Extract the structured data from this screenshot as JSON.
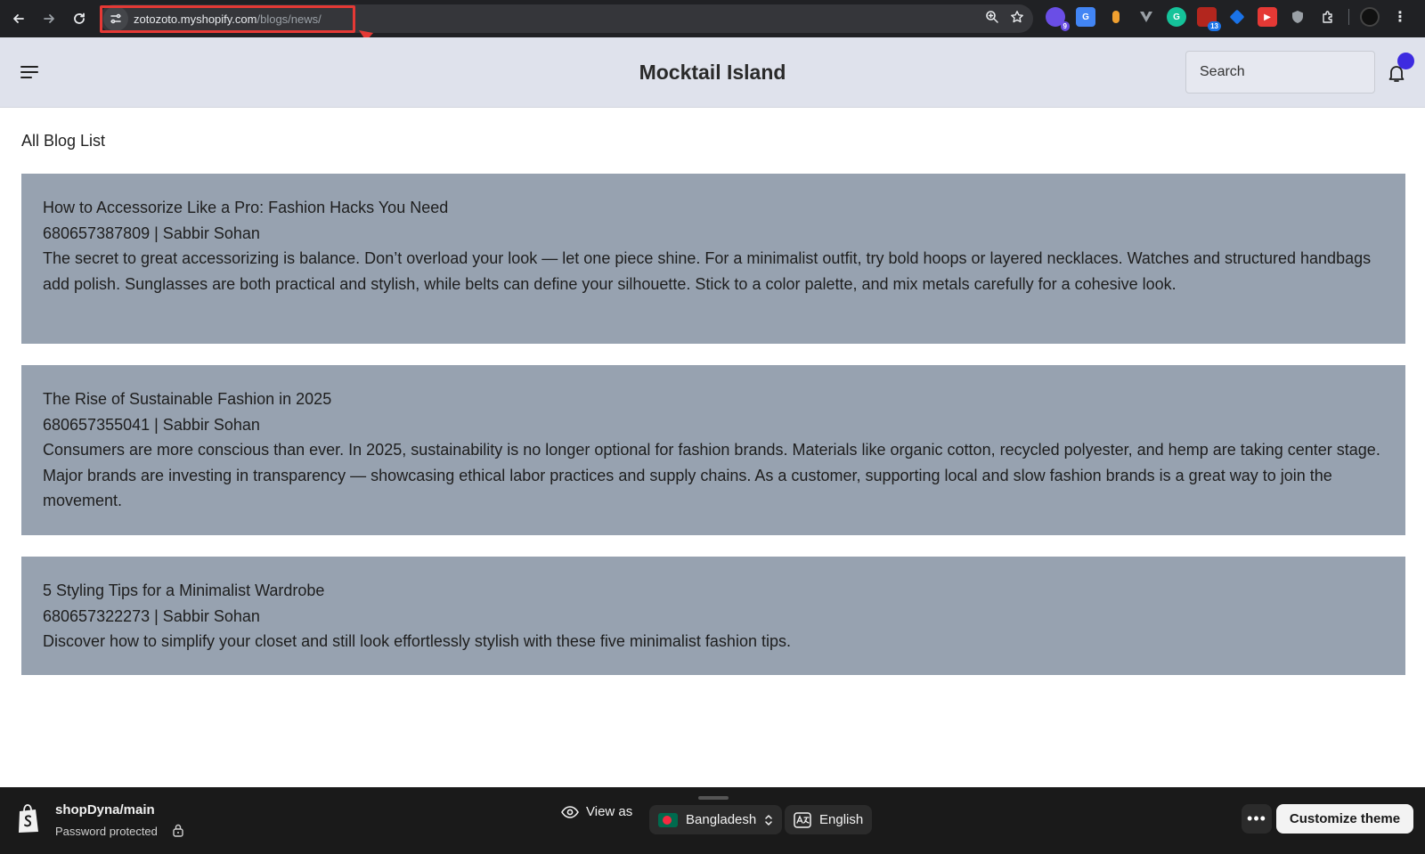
{
  "browser": {
    "url_host": "zotozoto.myshopify.com",
    "url_path": "/blogs/news/",
    "extensions": [
      {
        "name": "ext-purple",
        "color": "#6a4ee6",
        "badge": "9"
      },
      {
        "name": "ext-translate",
        "color": "#4285f4",
        "badge": ""
      },
      {
        "name": "ext-orange",
        "color": "#f0a030",
        "badge": ""
      },
      {
        "name": "ext-v",
        "color": "#5f6368",
        "badge": ""
      },
      {
        "name": "ext-grammarly",
        "color": "#15c39a",
        "badge": ""
      },
      {
        "name": "ext-calendar",
        "color": "#d93025",
        "badge": "13"
      },
      {
        "name": "ext-blue",
        "color": "#1a73e8",
        "badge": ""
      },
      {
        "name": "ext-red",
        "color": "#e53935",
        "badge": ""
      },
      {
        "name": "ext-shield",
        "color": "#9aa0a6",
        "badge": ""
      }
    ]
  },
  "store": {
    "title": "Mocktail Island",
    "search_placeholder": "Search"
  },
  "main": {
    "heading": "All Blog List",
    "posts": [
      {
        "title": "How to Accessorize Like a Pro: Fashion Hacks You Need",
        "meta": "680657387809 | Sabbir Sohan",
        "body": "The secret to great accessorizing is balance. Don’t overload your look — let one piece shine. For a minimalist outfit, try bold hoops or layered necklaces. Watches and structured handbags add polish. Sunglasses are both practical and stylish, while belts can define your silhouette. Stick to a color palette, and mix metals carefully for a cohesive look."
      },
      {
        "title": "The Rise of Sustainable Fashion in 2025",
        "meta": "680657355041 | Sabbir Sohan",
        "body": "Consumers are more conscious than ever. In 2025, sustainability is no longer optional for fashion brands. Materials like organic cotton, recycled polyester, and hemp are taking center stage. Major brands are investing in transparency — showcasing ethical labor practices and supply chains. As a customer, supporting local and slow fashion brands is a great way to join the movement."
      },
      {
        "title": "5 Styling Tips for a Minimalist Wardrobe",
        "meta": "680657322273 | Sabbir Sohan",
        "body": "Discover how to simplify your closet and still look effortlessly stylish with these five minimalist fashion tips."
      }
    ]
  },
  "admin_bar": {
    "theme_name": "shopDyna/main",
    "status": "Password protected",
    "view_as_label": "View as",
    "country": "Bangladesh",
    "language": "English",
    "more_label": "•••",
    "customize_label": "Customize theme"
  },
  "colors": {
    "card_bg": "#97a2b0",
    "header_bg": "#dfe2ec",
    "notification_dot": "#3d2be0",
    "annotation_red": "#e53935"
  }
}
